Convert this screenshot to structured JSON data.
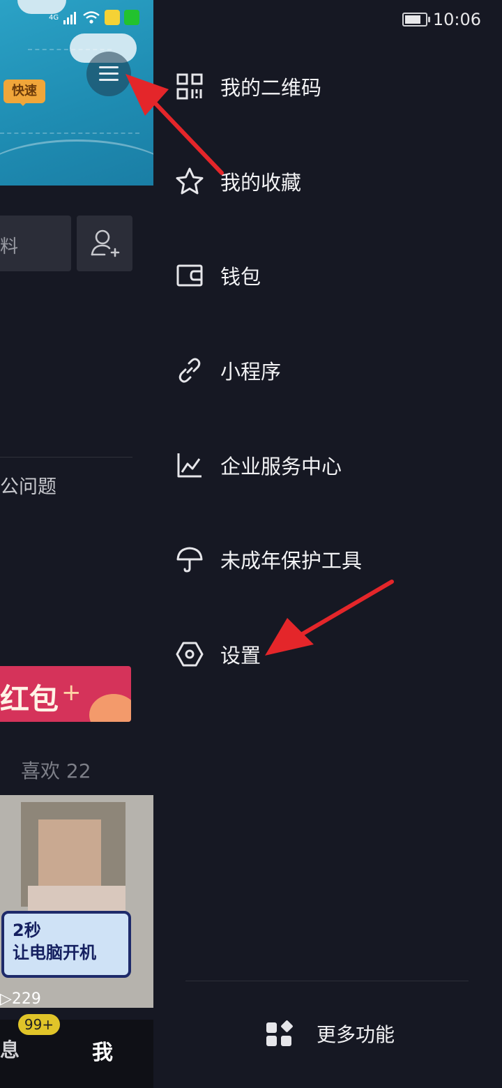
{
  "status_bar": {
    "time": "10:06",
    "network": "4G"
  },
  "background_page": {
    "banner_tag": "快速",
    "search_placeholder_partial": "料",
    "faq_partial": "公问题",
    "redpack_partial": "红包",
    "redpack_star": "+",
    "likes_label": "喜欢 22",
    "video_caption_line1": "2秒",
    "video_caption_line2": "让电脑开机",
    "video_play_count": "229",
    "tabs": {
      "messages_partial": "息",
      "messages_badge": "99+",
      "me": "我"
    }
  },
  "drawer": {
    "items": [
      {
        "label": "我的二维码",
        "icon": "qr-code-icon"
      },
      {
        "label": "我的收藏",
        "icon": "star-icon"
      },
      {
        "label": "钱包",
        "icon": "wallet-icon"
      },
      {
        "label": "小程序",
        "icon": "link-icon"
      },
      {
        "label": "企业服务中心",
        "icon": "chart-icon"
      },
      {
        "label": "未成年保护工具",
        "icon": "umbrella-icon"
      },
      {
        "label": "设置",
        "icon": "settings-hex-icon"
      }
    ],
    "more": {
      "label": "更多功能",
      "icon": "grid-icon"
    }
  },
  "annotation_color": "#e4262a"
}
